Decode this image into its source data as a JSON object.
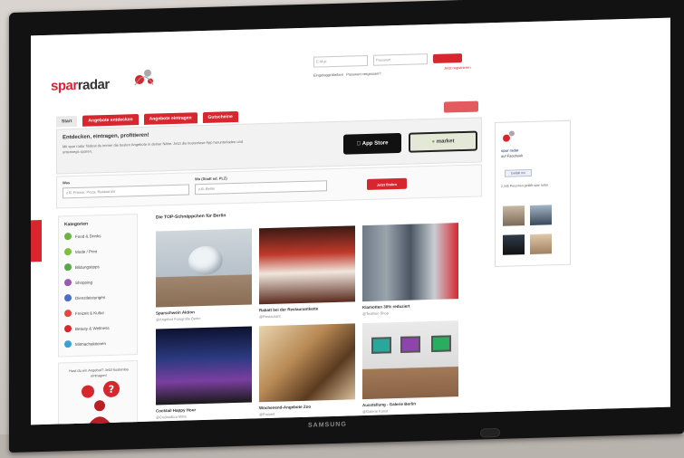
{
  "monitor": {
    "brand": "SAMSUNG"
  },
  "site": {
    "logo_left": "spar",
    "logo_right": "radar",
    "login": {
      "email_placeholder": "E-Mail",
      "password_placeholder": "Passwort",
      "remember": "Eingeloggt bleiben",
      "forgot": "Passwort vergessen?",
      "signup": "Jetzt registrieren"
    },
    "tabs": [
      "Start",
      "Angebote entdecken",
      "Angebote eintragen",
      "Gutscheine"
    ],
    "promo": {
      "title": "Entdecken, eintragen, profitieren!",
      "text": "Mit spar radar findest du immer die besten Angebote in deiner Nähe. Jetzt die kostenlose App herunterladen und unterwegs sparen.",
      "appstore": "App Store",
      "market": "market"
    },
    "search": {
      "was_label": "Was",
      "was_placeholder": "z.B. Friseur, Pizza, Restaurant",
      "wo_label": "Wo (Stadt od. PLZ)",
      "wo_placeholder": "z.B. Berlin",
      "button": "Jetzt finden"
    },
    "categories_title": "Kategorien",
    "categories": [
      {
        "label": "Food & Drinks",
        "color": "#6bb344"
      },
      {
        "label": "Mode / Print",
        "color": "#7fbf3f"
      },
      {
        "label": "Bildungstipps",
        "color": "#58a84a"
      },
      {
        "label": "Shopping",
        "color": "#9b59b6"
      },
      {
        "label": "Dienstleistungen",
        "color": "#4a6fc9"
      },
      {
        "label": "Freizeit & Kultur",
        "color": "#e2483d"
      },
      {
        "label": "Beauty & Wellness",
        "color": "#d7262e"
      },
      {
        "label": "Mitmachaktionen",
        "color": "#3aa0d8"
      }
    ],
    "help_text": "Hast du ein Angebot? Jetzt kostenlos eintragen!",
    "main_title": "Die TOP-Schnäppchen für Berlin",
    "cards": [
      {
        "title": "Sparschwein Aktion",
        "sub": "@Angebot Fotografie Berlin",
        "theme": "piggy"
      },
      {
        "title": "Rabatt bei der Restaurantkette",
        "sub": "@Restaurant",
        "theme": "restaurant"
      },
      {
        "title": "Klamotten 30% reduziert",
        "sub": "@Textilien Shop",
        "theme": "clothes"
      },
      {
        "title": "Cocktail Happy Hour",
        "sub": "@Cocktailbar Mitte",
        "theme": "bar"
      },
      {
        "title": "Wochenend-Angebote Zoo",
        "sub": "@Freizeit",
        "theme": "sushi"
      },
      {
        "title": "Ausstellung - Galerie Berlin",
        "sub": "@Galerie Kunst",
        "theme": "gallery"
      }
    ],
    "right_panel": {
      "text_line1": "spar radar",
      "text_line2": "auf Facebook",
      "like": "Gefällt mir",
      "fans": "2.345 Personen gefällt spar radar."
    }
  }
}
